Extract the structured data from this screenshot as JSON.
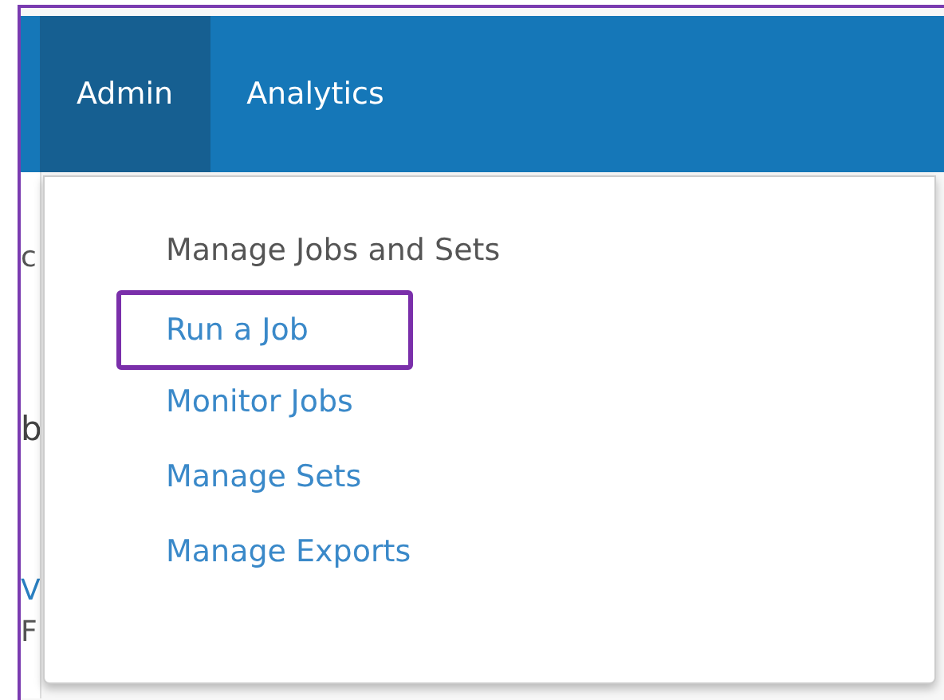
{
  "navbar": {
    "tabs": [
      {
        "label": "Admin",
        "selected": true
      },
      {
        "label": "Analytics",
        "selected": false
      }
    ]
  },
  "background_fragments": [
    {
      "text": "c",
      "kind": "text"
    },
    {
      "text": "b",
      "kind": "heading"
    },
    {
      "text": "V",
      "kind": "link"
    },
    {
      "text": "F",
      "kind": "text"
    }
  ],
  "dropdown": {
    "header": "Manage Jobs and Sets",
    "items": [
      {
        "label": "Run a Job",
        "highlighted": true
      },
      {
        "label": "Monitor Jobs",
        "highlighted": false
      },
      {
        "label": "Manage Sets",
        "highlighted": false
      },
      {
        "label": "Manage Exports",
        "highlighted": false
      }
    ]
  }
}
